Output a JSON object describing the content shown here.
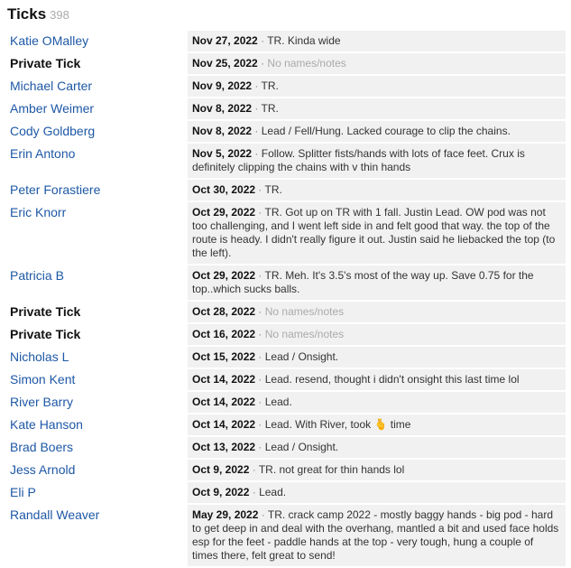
{
  "section": {
    "title": "Ticks",
    "count": "398"
  },
  "ticks": [
    {
      "name": "Katie OMalley",
      "private": false,
      "date": "Nov 27, 2022",
      "note": "TR. Kinda wide"
    },
    {
      "name": "Private Tick",
      "private": true,
      "date": "Nov 25, 2022",
      "note": "No names/notes"
    },
    {
      "name": "Michael Carter",
      "private": false,
      "date": "Nov 9, 2022",
      "note": "TR."
    },
    {
      "name": "Amber Weimer",
      "private": false,
      "date": "Nov 8, 2022",
      "note": "TR."
    },
    {
      "name": "Cody Goldberg",
      "private": false,
      "date": "Nov 8, 2022",
      "note": "Lead / Fell/Hung. Lacked courage to clip the chains."
    },
    {
      "name": "Erin Antono",
      "private": false,
      "date": "Nov 5, 2022",
      "note": "Follow. Splitter fists/hands with lots of face feet. Crux is definitely clipping the chains with v thin hands"
    },
    {
      "name": "Peter Forastiere",
      "private": false,
      "date": "Oct 30, 2022",
      "note": "TR."
    },
    {
      "name": "Eric Knorr",
      "private": false,
      "date": "Oct 29, 2022",
      "note": "TR. Got up on TR with 1 fall. Justin Lead. OW pod was not too challenging, and I went left side in and felt good that way. the top of the route is heady. I didn't really figure it out. Justin said he liebacked the top (to the left)."
    },
    {
      "name": "Patricia B",
      "private": false,
      "date": "Oct 29, 2022",
      "note": "TR. Meh. It's 3.5's most of the way up. Save 0.75 for the top..which sucks balls."
    },
    {
      "name": "Private Tick",
      "private": true,
      "date": "Oct 28, 2022",
      "note": "No names/notes"
    },
    {
      "name": "Private Tick",
      "private": true,
      "date": "Oct 16, 2022",
      "note": "No names/notes"
    },
    {
      "name": "Nicholas L",
      "private": false,
      "date": "Oct 15, 2022",
      "note": "Lead / Onsight."
    },
    {
      "name": "Simon Kent",
      "private": false,
      "date": "Oct 14, 2022",
      "note": "Lead. resend, thought i didn't onsight this last time lol"
    },
    {
      "name": "River Barry",
      "private": false,
      "date": "Oct 14, 2022",
      "note": "Lead."
    },
    {
      "name": "Kate Hanson",
      "private": false,
      "date": "Oct 14, 2022",
      "note": "Lead. With River, took 🫰 time"
    },
    {
      "name": "Brad Boers",
      "private": false,
      "date": "Oct 13, 2022",
      "note": "Lead / Onsight."
    },
    {
      "name": "Jess Arnold",
      "private": false,
      "date": "Oct 9, 2022",
      "note": "TR. not great for thin hands lol"
    },
    {
      "name": "Eli P",
      "private": false,
      "date": "Oct 9, 2022",
      "note": "Lead."
    },
    {
      "name": "Randall Weaver",
      "private": false,
      "date": "May 29, 2022",
      "note": "TR. crack camp 2022 - mostly baggy hands - big pod - hard to get deep in and deal with the overhang, mantled a bit and used face holds esp for the feet - paddle hands at the top - very tough, hung a couple of times there, felt great to send!"
    }
  ],
  "separator": "·",
  "colors": {
    "link": "#1e58a6",
    "note_bg": "#f1f1f1",
    "muted": "#aaaaaa"
  }
}
